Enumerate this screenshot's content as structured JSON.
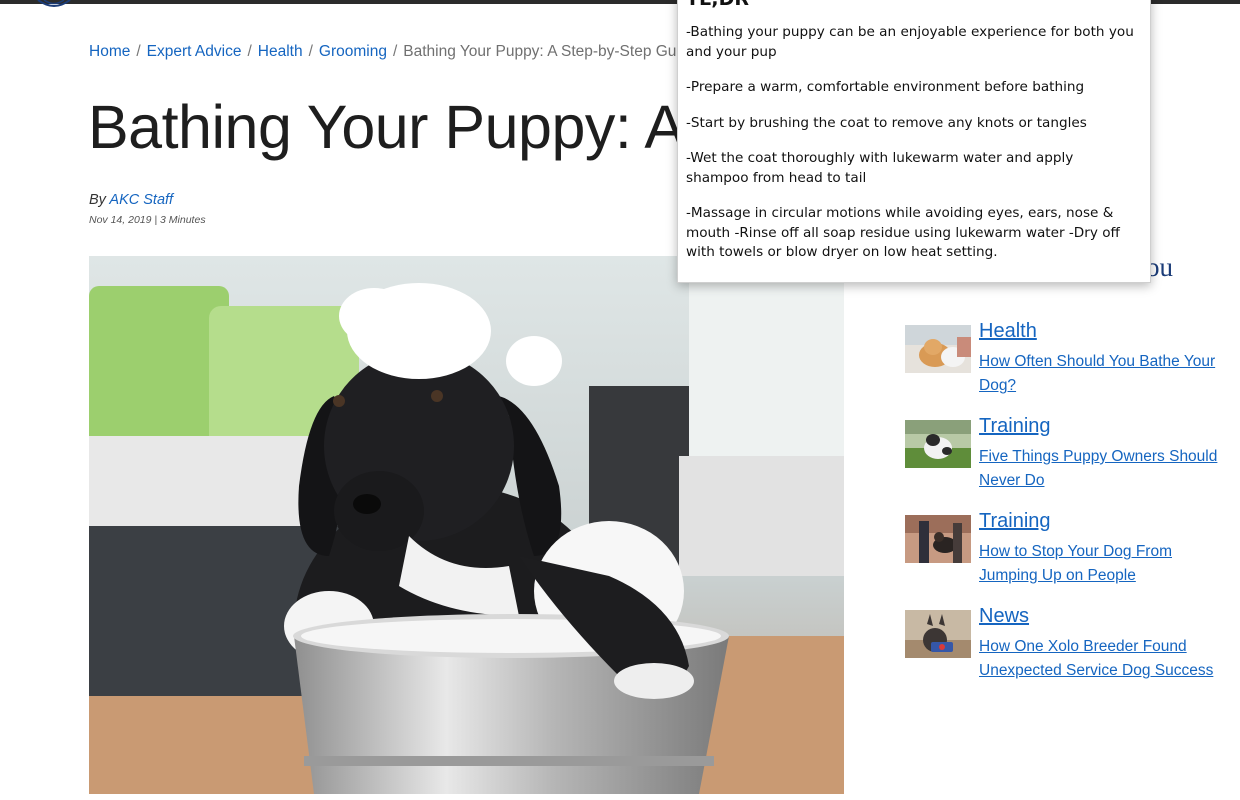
{
  "breadcrumb": {
    "home": "Home",
    "expert_advice": "Expert Advice",
    "health": "Health",
    "grooming": "Grooming",
    "current": "Bathing Your Puppy: A Step-by-Step Guide",
    "separator": "/"
  },
  "article": {
    "title": "Bathing Your Puppy: A S",
    "by_prefix": "By",
    "author": "AKC Staff",
    "date": "Nov 14, 2019",
    "meta_separator": "|",
    "read_time": "3 Minutes"
  },
  "sidebar": {
    "heading_fragment": "ou",
    "related": [
      {
        "category": "Health",
        "headline": "How Often Should You Bathe Your Dog?",
        "thumb": "corgi-bath"
      },
      {
        "category": "Training",
        "headline": "Five Things Puppy Owners Should Never Do",
        "thumb": "puppy-on-grass"
      },
      {
        "category": "Training",
        "headline": "How to Stop Your Dog From Jumping Up on People",
        "thumb": "dog-jumping-on-person"
      },
      {
        "category": "News",
        "headline": "How One Xolo Breeder Found Unexpected Service Dog Success",
        "thumb": "xolo-service-dog"
      }
    ]
  },
  "tldr": {
    "title": "TL;DR",
    "items": [
      "-Bathing your puppy can be an enjoyable experience for both you and your pup",
      "-Prepare a warm, comfortable environment before bathing",
      "-Start by brushing the coat to remove any knots or tangles",
      "-Wet the coat thoroughly with lukewarm water and apply shampoo from head to tail",
      "-Massage in circular motions while avoiding eyes, ears, nose & mouth -Rinse off all soap residue using lukewarm water -Dry off with towels or blow dryer on low heat setting."
    ]
  },
  "colors": {
    "link": "#1565c0",
    "title": "#1e1e1e",
    "topbar": "#2b2b2b",
    "sidebar_heading": "#1b3c78"
  },
  "icons": {
    "logo": "akc-logo-icon"
  }
}
